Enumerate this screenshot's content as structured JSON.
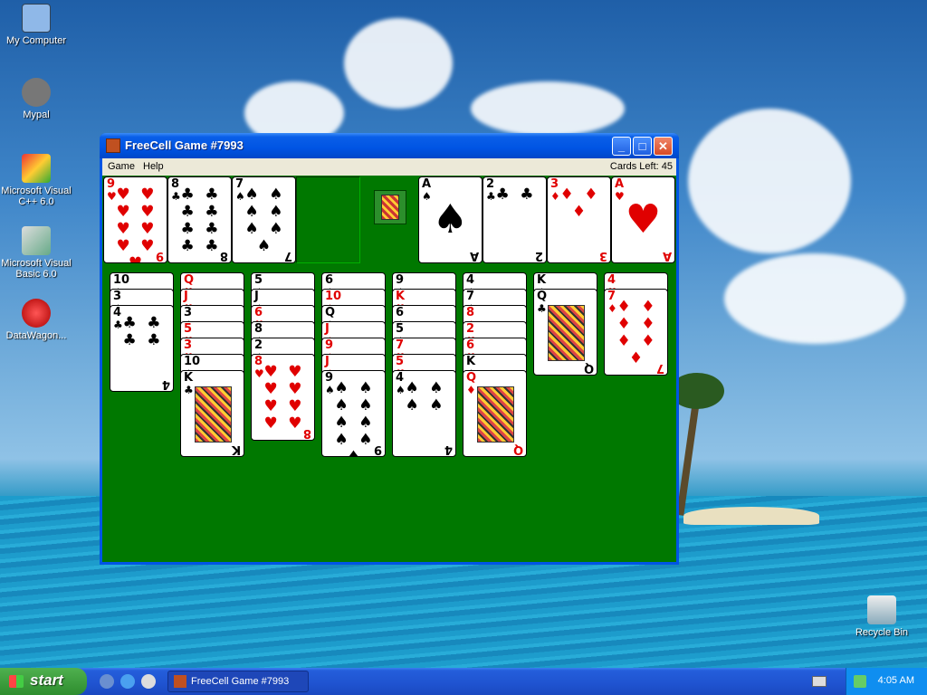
{
  "desktop": {
    "icons": [
      {
        "label": "My Computer"
      },
      {
        "label": "Mypal"
      },
      {
        "label": "Microsoft Visual C++ 6.0"
      },
      {
        "label": "Microsoft Visual Basic 6.0"
      },
      {
        "label": "DataWagon..."
      },
      {
        "label": "Recycle Bin"
      }
    ]
  },
  "window": {
    "title": "FreeCell Game #7993",
    "controls": {
      "minimize": "_",
      "maximize": "□",
      "close": "✕"
    },
    "menu": [
      "Game",
      "Help"
    ],
    "cards_left": "Cards Left: 45"
  },
  "game": {
    "free_cells": [
      {
        "rank": "9",
        "suit": "♥",
        "color": "red"
      },
      {
        "rank": "8",
        "suit": "♣",
        "color": "black"
      },
      {
        "rank": "7",
        "suit": "♠",
        "color": "black"
      },
      null
    ],
    "foundations": [
      {
        "rank": "A",
        "suit": "♠",
        "color": "black"
      },
      {
        "rank": "2",
        "suit": "♣",
        "color": "black"
      },
      {
        "rank": "3",
        "suit": "♦",
        "color": "red"
      },
      {
        "rank": "A",
        "suit": "♥",
        "color": "red"
      }
    ],
    "columns": [
      [
        {
          "r": "10",
          "s": "♠",
          "c": "black"
        },
        {
          "r": "3",
          "s": "♠",
          "c": "black"
        },
        {
          "r": "4",
          "s": "♣",
          "c": "black"
        }
      ],
      [
        {
          "r": "Q",
          "s": "♥",
          "c": "red"
        },
        {
          "r": "J",
          "s": "♥",
          "c": "red"
        },
        {
          "r": "3",
          "s": "♠",
          "c": "black"
        },
        {
          "r": "5",
          "s": "♥",
          "c": "red"
        },
        {
          "r": "3",
          "s": "♥",
          "c": "red"
        },
        {
          "r": "10",
          "s": "♠",
          "c": "black"
        },
        {
          "r": "K",
          "s": "♣",
          "c": "black"
        }
      ],
      [
        {
          "r": "5",
          "s": "♠",
          "c": "black"
        },
        {
          "r": "J",
          "s": "♠",
          "c": "black"
        },
        {
          "r": "6",
          "s": "♥",
          "c": "red"
        },
        {
          "r": "8",
          "s": "♠",
          "c": "black"
        },
        {
          "r": "2",
          "s": "♠",
          "c": "black"
        },
        {
          "r": "8",
          "s": "♥",
          "c": "red"
        }
      ],
      [
        {
          "r": "6",
          "s": "♠",
          "c": "black"
        },
        {
          "r": "10",
          "s": "♦",
          "c": "red"
        },
        {
          "r": "Q",
          "s": "♠",
          "c": "black"
        },
        {
          "r": "J",
          "s": "♦",
          "c": "red"
        },
        {
          "r": "9",
          "s": "♦",
          "c": "red"
        },
        {
          "r": "J",
          "s": "♦",
          "c": "red"
        },
        {
          "r": "9",
          "s": "♠",
          "c": "black"
        }
      ],
      [
        {
          "r": "9",
          "s": "♠",
          "c": "black"
        },
        {
          "r": "K",
          "s": "♥",
          "c": "red"
        },
        {
          "r": "6",
          "s": "♠",
          "c": "black"
        },
        {
          "r": "5",
          "s": "♠",
          "c": "black"
        },
        {
          "r": "7",
          "s": "♥",
          "c": "red"
        },
        {
          "r": "5",
          "s": "♥",
          "c": "red"
        },
        {
          "r": "4",
          "s": "♠",
          "c": "black"
        }
      ],
      [
        {
          "r": "4",
          "s": "♠",
          "c": "black"
        },
        {
          "r": "7",
          "s": "♠",
          "c": "black"
        },
        {
          "r": "8",
          "s": "♦",
          "c": "red"
        },
        {
          "r": "2",
          "s": "♥",
          "c": "red"
        },
        {
          "r": "6",
          "s": "♥",
          "c": "red"
        },
        {
          "r": "K",
          "s": "♠",
          "c": "black"
        },
        {
          "r": "Q",
          "s": "♦",
          "c": "red"
        }
      ],
      [
        {
          "r": "K",
          "s": "♠",
          "c": "black"
        },
        {
          "r": "Q",
          "s": "♣",
          "c": "black"
        }
      ],
      [
        {
          "r": "4",
          "s": "♥",
          "c": "red"
        },
        {
          "r": "7",
          "s": "♦",
          "c": "red"
        }
      ]
    ]
  },
  "taskbar": {
    "start_label": "start",
    "task_button": "FreeCell Game #7993",
    "clock": "4:05 AM"
  }
}
